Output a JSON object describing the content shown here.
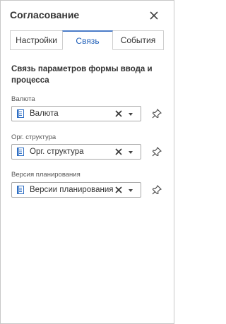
{
  "panel": {
    "title": "Согласование"
  },
  "tabs": [
    {
      "label": "Настройки"
    },
    {
      "label": "Связь"
    },
    {
      "label": "События"
    }
  ],
  "active_tab": "Связь",
  "section_title": "Связь параметров формы ввода и процесса",
  "fields": [
    {
      "label": "Валюта",
      "value": "Валюта"
    },
    {
      "label": "Орг. структура",
      "value": "Орг. структура"
    },
    {
      "label": "Версия планирования",
      "value": "Версии планирования"
    }
  ],
  "colors": {
    "accent": "#4a7cc8",
    "doc_icon": "#2f6fc4"
  },
  "icons": {
    "close": "close-icon",
    "doc": "document-icon",
    "clear": "clear-icon",
    "dropdown": "chevron-down-icon",
    "pin": "pin-icon"
  }
}
